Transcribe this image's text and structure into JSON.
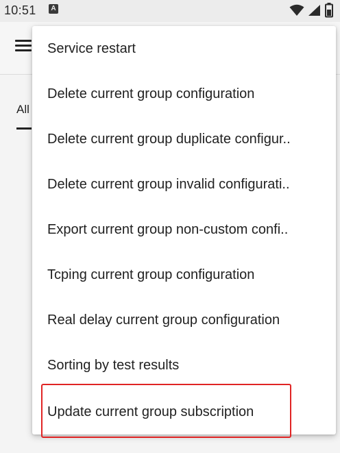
{
  "status_bar": {
    "time": "10:51",
    "notification_glyph": "A",
    "icons": [
      "wifi-icon",
      "signal-icon",
      "battery-icon"
    ]
  },
  "toolbar": {
    "menu_icon": "hamburger-menu-icon"
  },
  "tabs": {
    "partial_label": "All"
  },
  "popup_menu": {
    "items": [
      {
        "label": "Service restart"
      },
      {
        "label": "Delete current group configuration"
      },
      {
        "label": "Delete current group duplicate configur.."
      },
      {
        "label": "Delete current group invalid configurati.."
      },
      {
        "label": "Export current group non-custom confi.."
      },
      {
        "label": "Tcping current group configuration"
      },
      {
        "label": "Real delay current group configuration"
      },
      {
        "label": "Sorting by test results"
      },
      {
        "label": "Update current group subscription"
      }
    ],
    "highlighted_item_index": 8
  },
  "colors": {
    "highlight_border": "#e02424",
    "menu_background": "#ffffff",
    "status_bar_background": "#ececec"
  }
}
